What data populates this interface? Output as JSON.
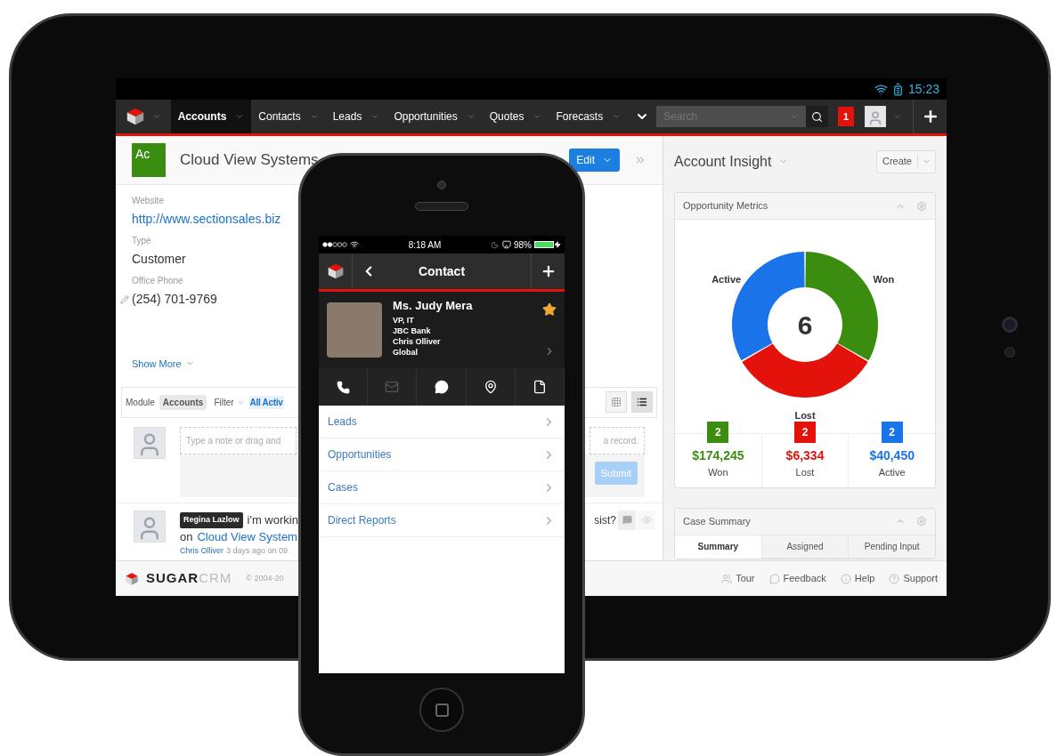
{
  "tablet": {
    "status_bar": {
      "time": "15:23"
    },
    "nav": {
      "tabs": [
        {
          "label": "Accounts",
          "selected": true
        },
        {
          "label": "Contacts",
          "selected": false
        },
        {
          "label": "Leads",
          "selected": false
        },
        {
          "label": "Opportunities",
          "selected": false
        },
        {
          "label": "Quotes",
          "selected": false
        },
        {
          "label": "Forecasts",
          "selected": false
        }
      ],
      "search": {
        "placeholder": "Search"
      },
      "notifications": "1"
    },
    "record": {
      "badge": "Ac",
      "title": "Cloud View Systems",
      "edit_button": "Edit",
      "fields": [
        {
          "label": "Website",
          "value": "http://www.sectionsales.biz",
          "kind": "link"
        },
        {
          "label": "Type",
          "value": "Customer",
          "kind": "text"
        },
        {
          "label": "Office Phone",
          "value": "(254) 701-9769",
          "kind": "phone"
        }
      ],
      "show_more": "Show More"
    },
    "activity": {
      "module_label": "Module",
      "module": "Accounts",
      "filter": "Filter",
      "filter_value": "All Activ",
      "views": [
        {
          "kind": "grid",
          "selected": false
        },
        {
          "kind": "list",
          "selected": true
        }
      ],
      "note_placeholder_start": "Type a note or drag and",
      "note_placeholder_end": "a record.",
      "submit": "Submit",
      "submit_disabled": true,
      "posts": [
        {
          "author": "Regina Lazlow",
          "text": "i'm workin",
          "text_end": "sist?",
          "link_prefix": "on",
          "link": "Cloud View System",
          "meta_author": "Chris Olliver",
          "meta": "3 days ago on 09"
        }
      ]
    },
    "footer": {
      "brand": "SUGAR",
      "brand_accent": "CRM",
      "copyright": "© 2004-20",
      "links": [
        {
          "kind": "tour",
          "label": "Tour"
        },
        {
          "kind": "feedback",
          "label": "Feedback"
        },
        {
          "kind": "help",
          "label": "Help"
        },
        {
          "kind": "support",
          "label": "Support"
        }
      ]
    },
    "insight": {
      "title": "Account Insight",
      "create": "Create",
      "metrics_dashlet": {
        "title": "Opportunity Metrics",
        "center_label": "6",
        "chart_data": {
          "type": "donut",
          "categories": [
            "Won",
            "Lost",
            "Active"
          ],
          "series": [
            {
              "values": [
                33.33,
                33.33,
                33.34
              ]
            }
          ]
        },
        "metrics": [
          {
            "count": "2",
            "amount": "$174,245",
            "label": "Won",
            "color": "#3b8d10"
          },
          {
            "count": "2",
            "amount": "$6,334",
            "label": "Lost",
            "color": "#e3120b"
          },
          {
            "count": "2",
            "amount": "$40,450",
            "label": "Active",
            "color": "#1a73e8"
          }
        ]
      },
      "case_dashlet": {
        "title": "Case Summary",
        "tabs": [
          {
            "label": "Summary",
            "selected": true
          },
          {
            "label": "Assigned",
            "selected": false
          },
          {
            "label": "Pending Input",
            "selected": false
          }
        ]
      }
    }
  },
  "phone": {
    "status_bar": {
      "time": "8:18 AM",
      "battery": "98%"
    },
    "header": {
      "title": "Contact"
    },
    "contact": {
      "name": "Ms. Judy Mera",
      "lines": [
        "VP, IT",
        "JBC Bank",
        "Chris Olliver",
        "Global"
      ],
      "favorite": true
    },
    "actions": [
      {
        "kind": "call",
        "disabled": false
      },
      {
        "kind": "email",
        "disabled": true
      },
      {
        "kind": "message",
        "disabled": false
      },
      {
        "kind": "map",
        "disabled": false
      },
      {
        "kind": "note",
        "disabled": false
      }
    ],
    "related": [
      {
        "label": "Leads"
      },
      {
        "label": "Opportunities"
      },
      {
        "label": "Cases"
      },
      {
        "label": "Direct Reports"
      }
    ]
  }
}
